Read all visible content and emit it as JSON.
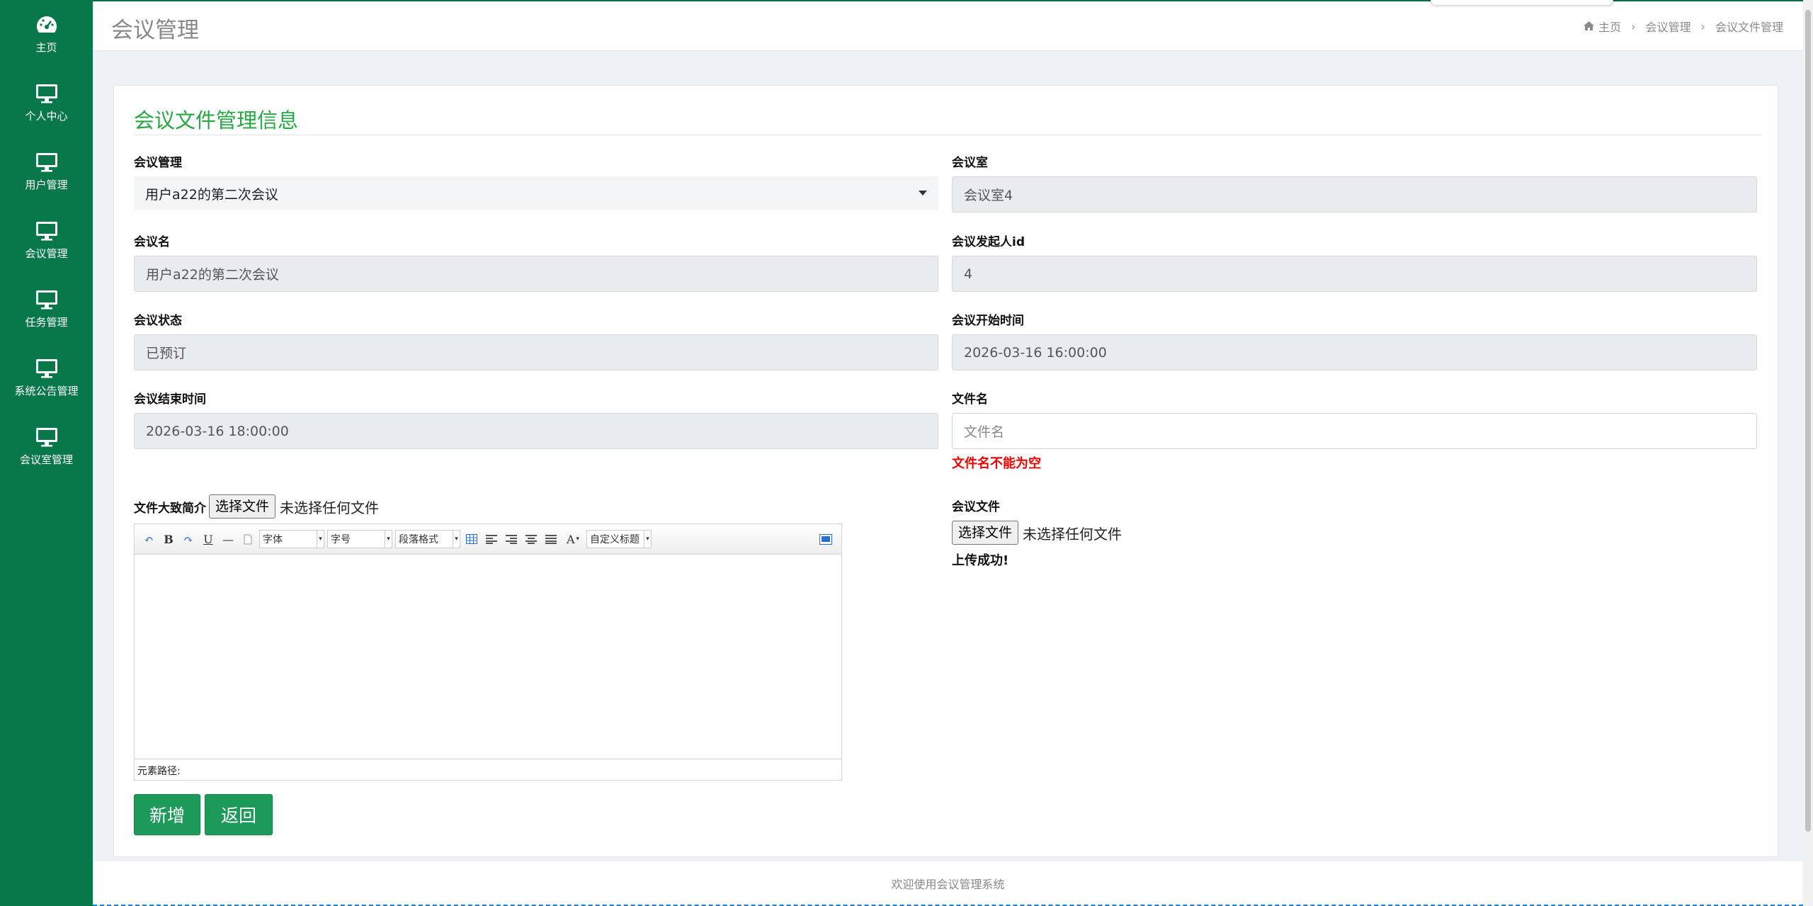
{
  "sidebar": {
    "items": [
      {
        "label": "主页",
        "icon": "dashboard-icon"
      },
      {
        "label": "个人中心",
        "icon": "monitor-icon"
      },
      {
        "label": "用户管理",
        "icon": "monitor-icon"
      },
      {
        "label": "会议管理",
        "icon": "monitor-icon"
      },
      {
        "label": "任务管理",
        "icon": "monitor-icon"
      },
      {
        "label": "系统公告管理",
        "icon": "monitor-icon"
      },
      {
        "label": "会议室管理",
        "icon": "monitor-icon"
      }
    ]
  },
  "header": {
    "title": "会议管理",
    "breadcrumb": [
      "主页",
      "会议管理",
      "会议文件管理"
    ]
  },
  "form": {
    "title": "会议文件管理信息",
    "meeting_mgmt": {
      "label": "会议管理",
      "value": "用户a22的第二次会议"
    },
    "room": {
      "label": "会议室",
      "value": "会议室4"
    },
    "meeting_name": {
      "label": "会议名",
      "value": "用户a22的第二次会议"
    },
    "initiator_id": {
      "label": "会议发起人id",
      "value": "4"
    },
    "status": {
      "label": "会议状态",
      "value": "已预订"
    },
    "start_time": {
      "label": "会议开始时间",
      "value": "2026-03-16 16:00:00"
    },
    "end_time": {
      "label": "会议结束时间",
      "value": "2026-03-16 18:00:00"
    },
    "file_name": {
      "label": "文件名",
      "placeholder": "文件名",
      "error": "文件名不能为空"
    },
    "summary": {
      "label": "文件大致简介",
      "button": "选择文件",
      "note": "未选择任何文件"
    },
    "meeting_file": {
      "label": "会议文件",
      "button": "选择文件",
      "note": "未选择任何文件",
      "success": "上传成功!"
    }
  },
  "editor": {
    "font_combo": "字体",
    "size_combo": "字号",
    "para_combo": "段落格式",
    "custom_combo": "自定义标题",
    "status": "元素路径:"
  },
  "buttons": {
    "add": "新增",
    "back": "返回"
  },
  "footer": {
    "text": "欢迎使用会议管理系统"
  },
  "colors": {
    "sidebar": "#08784a",
    "accent": "#28a745",
    "error": "#e00000",
    "button": "#1d9a5a"
  }
}
